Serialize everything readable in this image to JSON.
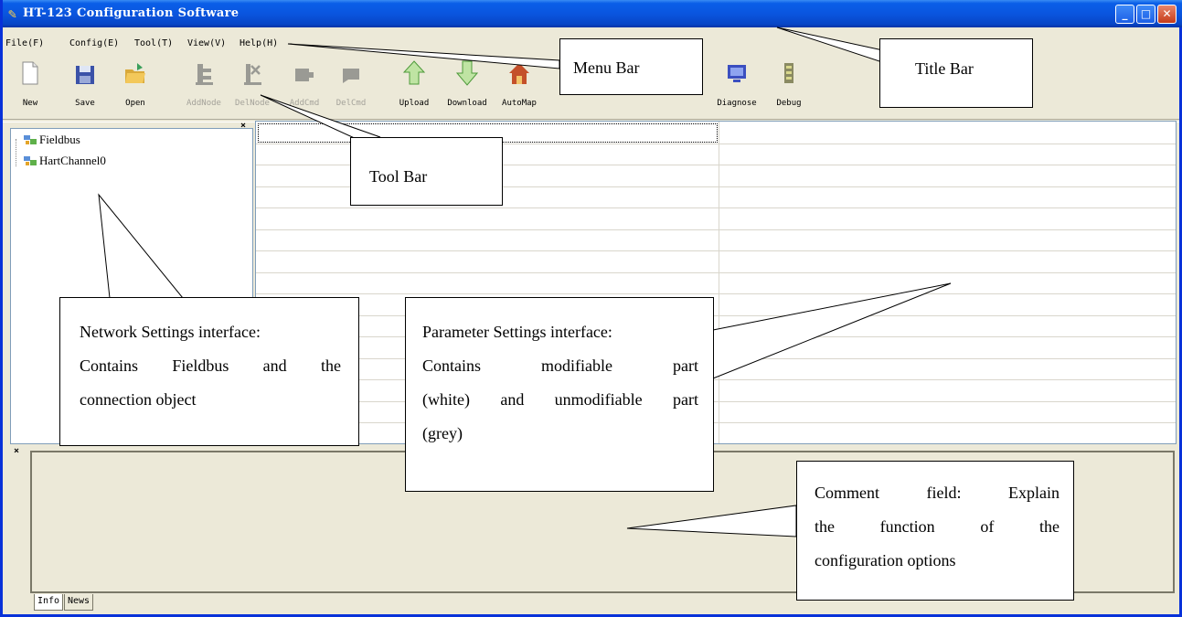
{
  "window": {
    "title": "HT-123 Configuration Software",
    "controls": {
      "minimize": "_",
      "maximize": "□",
      "close": "✕"
    }
  },
  "menu": [
    "File(F)",
    "Config(E)",
    "Tool(T)",
    "View(V)",
    "Help(H)"
  ],
  "toolbar": [
    {
      "label": "New",
      "icon": "new-file-icon",
      "enabled": true
    },
    {
      "label": "Save",
      "icon": "save-icon",
      "enabled": true
    },
    {
      "label": "Open",
      "icon": "open-folder-icon",
      "enabled": true
    },
    {
      "label": "AddNode",
      "icon": "add-node-icon",
      "enabled": false
    },
    {
      "label": "DelNode",
      "icon": "del-node-icon",
      "enabled": false
    },
    {
      "label": "AddCmd",
      "icon": "add-cmd-icon",
      "enabled": false
    },
    {
      "label": "DelCmd",
      "icon": "del-cmd-icon",
      "enabled": false
    },
    {
      "label": "Upload",
      "icon": "upload-arrow-icon",
      "enabled": true
    },
    {
      "label": "Download",
      "icon": "download-arrow-icon",
      "enabled": true
    },
    {
      "label": "AutoMap",
      "icon": "house-icon",
      "enabled": true
    },
    {
      "label": "Diagnose",
      "icon": "monitor-icon",
      "enabled": true
    },
    {
      "label": "Debug",
      "icon": "debug-icon",
      "enabled": true
    }
  ],
  "tree": {
    "close": "×",
    "items": [
      {
        "label": "Fieldbus",
        "icon": "network-node-icon"
      },
      {
        "label": "HartChannel0",
        "icon": "network-node-icon"
      }
    ]
  },
  "bottom": {
    "close": "×",
    "tabs": [
      "Info",
      "News"
    ]
  },
  "annotations": {
    "menu_bar": "Menu Bar",
    "title_bar": "Title Bar",
    "tool_bar": "Tool Bar",
    "network": [
      "Network Settings interface:",
      "Contains Fieldbus and the",
      "connection object"
    ],
    "parameter": [
      "Parameter Settings interface:",
      "Contains modifiable part",
      "(white) and unmodifiable part",
      "(grey)"
    ],
    "comment": [
      "Comment field: Explain",
      "the function of the",
      "configuration options"
    ]
  },
  "colors": {
    "title_bar": "#0a55df",
    "window_bg": "#ece9d8",
    "disabled_text": "#a4a29a"
  }
}
